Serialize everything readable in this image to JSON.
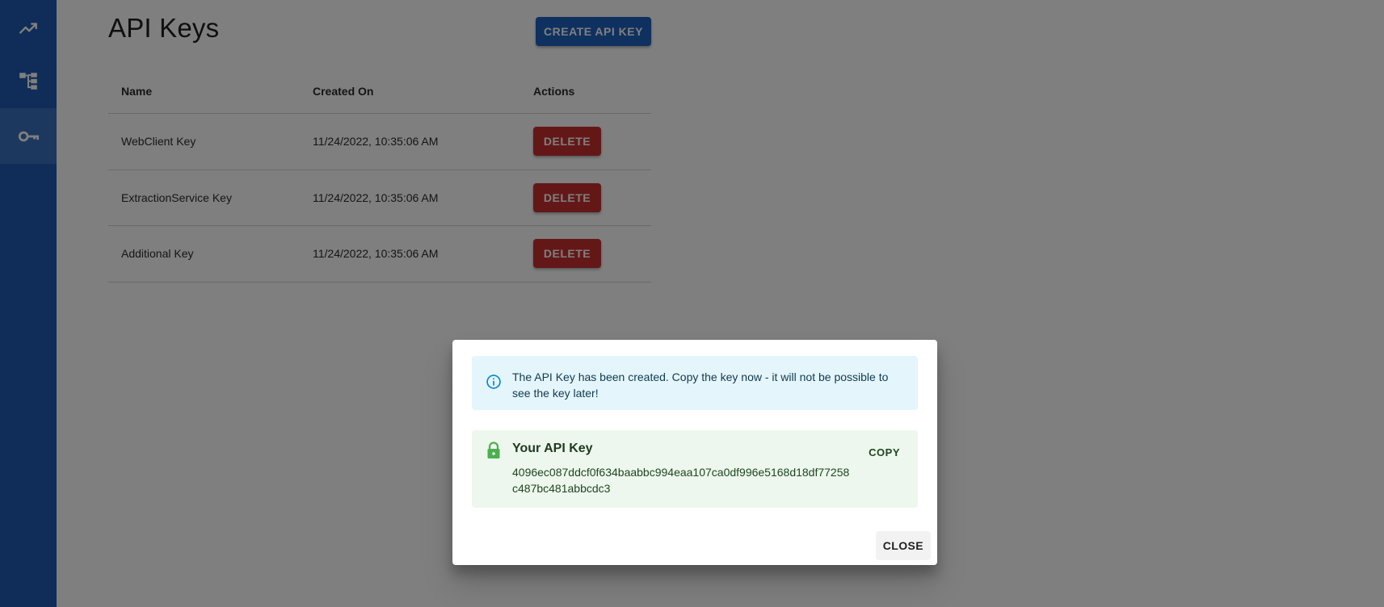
{
  "sidebar": {
    "items": [
      {
        "name": "analytics",
        "icon": "trending-up-icon"
      },
      {
        "name": "structure",
        "icon": "account-tree-icon"
      },
      {
        "name": "api-keys",
        "icon": "vpn-key-icon",
        "active": true
      }
    ],
    "color": "#1f5bb0"
  },
  "page": {
    "title": "API Keys",
    "create_label": "CREATE API KEY"
  },
  "table": {
    "headers": [
      "Name",
      "Created On",
      "Actions"
    ],
    "rows": [
      {
        "name": "WebClient Key",
        "created": "11/24/2022, 10:35:06 AM",
        "action": "DELETE"
      },
      {
        "name": "ExtractionService Key",
        "created": "11/24/2022, 10:35:06 AM",
        "action": "DELETE"
      },
      {
        "name": "Additional Key",
        "created": "11/24/2022, 10:35:06 AM",
        "action": "DELETE"
      }
    ]
  },
  "dialog": {
    "info_message": "The API Key has been created. Copy the key now - it will not be possible to see the key later!",
    "key_title": "Your API Key",
    "key_value": "4096ec087ddcf0f634baabbc994eaa107ca0df996e5168d18df77258c487bc481abbcdc3",
    "copy_label": "COPY",
    "close_label": "CLOSE"
  },
  "colors": {
    "primary": "#1f63be",
    "danger": "#c6302e",
    "info_bg": "#e5f5fc",
    "info_icon": "#0288d1",
    "success_bg": "#edf7ed",
    "success_icon": "#4caf50"
  }
}
